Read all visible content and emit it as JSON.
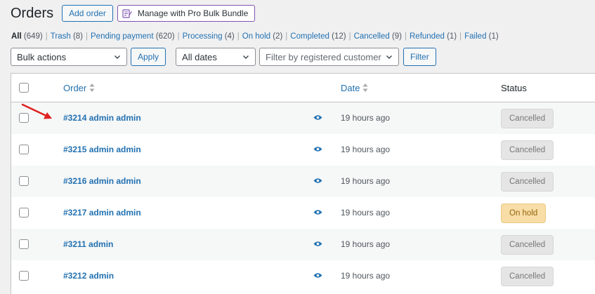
{
  "header": {
    "title": "Orders",
    "add_order_label": "Add order",
    "bundle_label": "Manage with Pro Bulk Bundle"
  },
  "filters": [
    {
      "label": "All",
      "count": "(649)",
      "current": true
    },
    {
      "label": "Trash",
      "count": "(8)"
    },
    {
      "label": "Pending payment",
      "count": "(620)"
    },
    {
      "label": "Processing",
      "count": "(4)"
    },
    {
      "label": "On hold",
      "count": "(2)"
    },
    {
      "label": "Completed",
      "count": "(12)"
    },
    {
      "label": "Cancelled",
      "count": "(9)"
    },
    {
      "label": "Refunded",
      "count": "(1)"
    },
    {
      "label": "Failed",
      "count": "(1)"
    }
  ],
  "tablenav": {
    "bulk_actions": "Bulk actions",
    "apply_label": "Apply",
    "dates": "All dates",
    "customer_placeholder": "Filter by registered customer",
    "filter_label": "Filter"
  },
  "columns": {
    "order": "Order",
    "date": "Date",
    "status": "Status"
  },
  "orders": [
    {
      "title": "#3214 admin admin",
      "date": "19 hours ago",
      "status": "Cancelled",
      "status_key": "cancelled"
    },
    {
      "title": "#3215 admin admin",
      "date": "19 hours ago",
      "status": "Cancelled",
      "status_key": "cancelled"
    },
    {
      "title": "#3216 admin admin",
      "date": "19 hours ago",
      "status": "Cancelled",
      "status_key": "cancelled"
    },
    {
      "title": "#3217 admin admin",
      "date": "19 hours ago",
      "status": "On hold",
      "status_key": "on-hold"
    },
    {
      "title": "#3211 admin",
      "date": "19 hours ago",
      "status": "Cancelled",
      "status_key": "cancelled"
    },
    {
      "title": "#3212 admin",
      "date": "19 hours ago",
      "status": "Cancelled",
      "status_key": "cancelled"
    }
  ],
  "colors": {
    "accent": "#2271b1",
    "annotation_arrow": "#e02020"
  }
}
